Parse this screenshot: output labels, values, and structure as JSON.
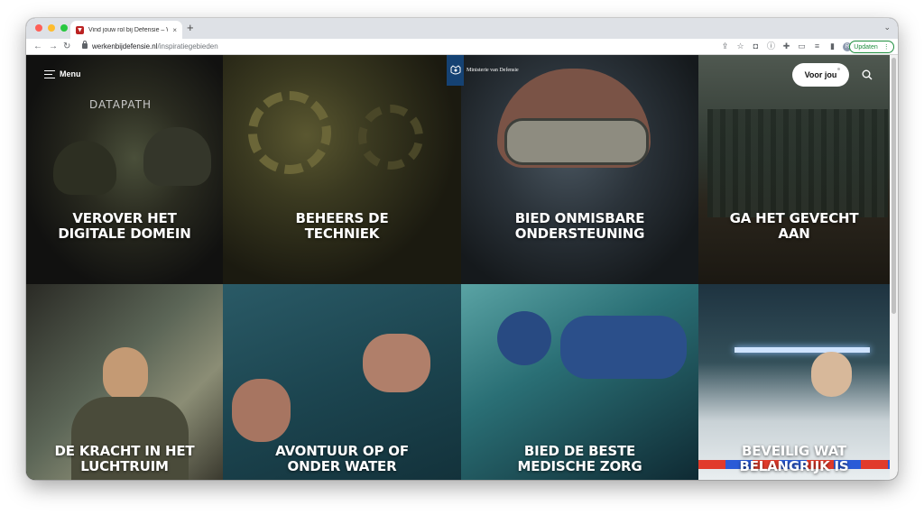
{
  "browser": {
    "tab_title": "Vind jouw rol bij Defensie – We",
    "tab_close": "×",
    "new_tab": "+",
    "url_domain": "werkenbijdefensie.nl",
    "url_path": "/inspiratiegebieden",
    "profile_initial": "R",
    "update_label": "Updaten",
    "colors": {
      "close": "#ff5f57",
      "minimize": "#febc2e",
      "maximize": "#28c840",
      "update": "#1e8e3e"
    }
  },
  "site": {
    "menu_label": "Menu",
    "logo_text": "Ministerie van Defensie",
    "cta_label": "Voor jou",
    "brand_color": "#154273"
  },
  "tiles": [
    {
      "label_line1": "VEROVER HET",
      "label_line2": "DIGITALE DOMEIN"
    },
    {
      "label_line1": "BEHEERS DE",
      "label_line2": "TECHNIEK"
    },
    {
      "label_line1": "BIED ONMISBARE",
      "label_line2": "ONDERSTEUNING"
    },
    {
      "label_line1": "GA HET GEVECHT",
      "label_line2": "AAN"
    },
    {
      "label_line1": "DE KRACHT IN HET",
      "label_line2": "LUCHTRUIM"
    },
    {
      "label_line1": "AVONTUUR OP OF",
      "label_line2": "ONDER WATER"
    },
    {
      "label_line1": "BIED DE BESTE",
      "label_line2": "MEDISCHE ZORG"
    },
    {
      "label_line1": "BEVEILIG WAT",
      "label_line2": "BELANGRIJK IS"
    }
  ],
  "tile1_overlay_text": "DATAPATH"
}
